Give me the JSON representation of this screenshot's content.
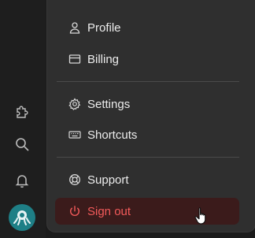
{
  "menu": {
    "items": [
      {
        "label": "Profile",
        "icon": "user-icon"
      },
      {
        "label": "Billing",
        "icon": "credit-card-icon"
      },
      {
        "label": "Settings",
        "icon": "gear-icon"
      },
      {
        "label": "Shortcuts",
        "icon": "keyboard-icon"
      },
      {
        "label": "Support",
        "icon": "lifebuoy-icon"
      },
      {
        "label": "Sign out",
        "icon": "power-icon"
      }
    ]
  },
  "rail": {
    "icons": [
      "puzzle-icon",
      "search-icon",
      "bell-icon"
    ],
    "avatar_icon": "octopus-logo-icon"
  },
  "colors": {
    "menu_bg": "#2f2f2f",
    "text": "#ececec",
    "danger_text": "#f35a5a",
    "danger_bg": "#3b1b1b",
    "avatar_bg": "#1e7f86"
  }
}
